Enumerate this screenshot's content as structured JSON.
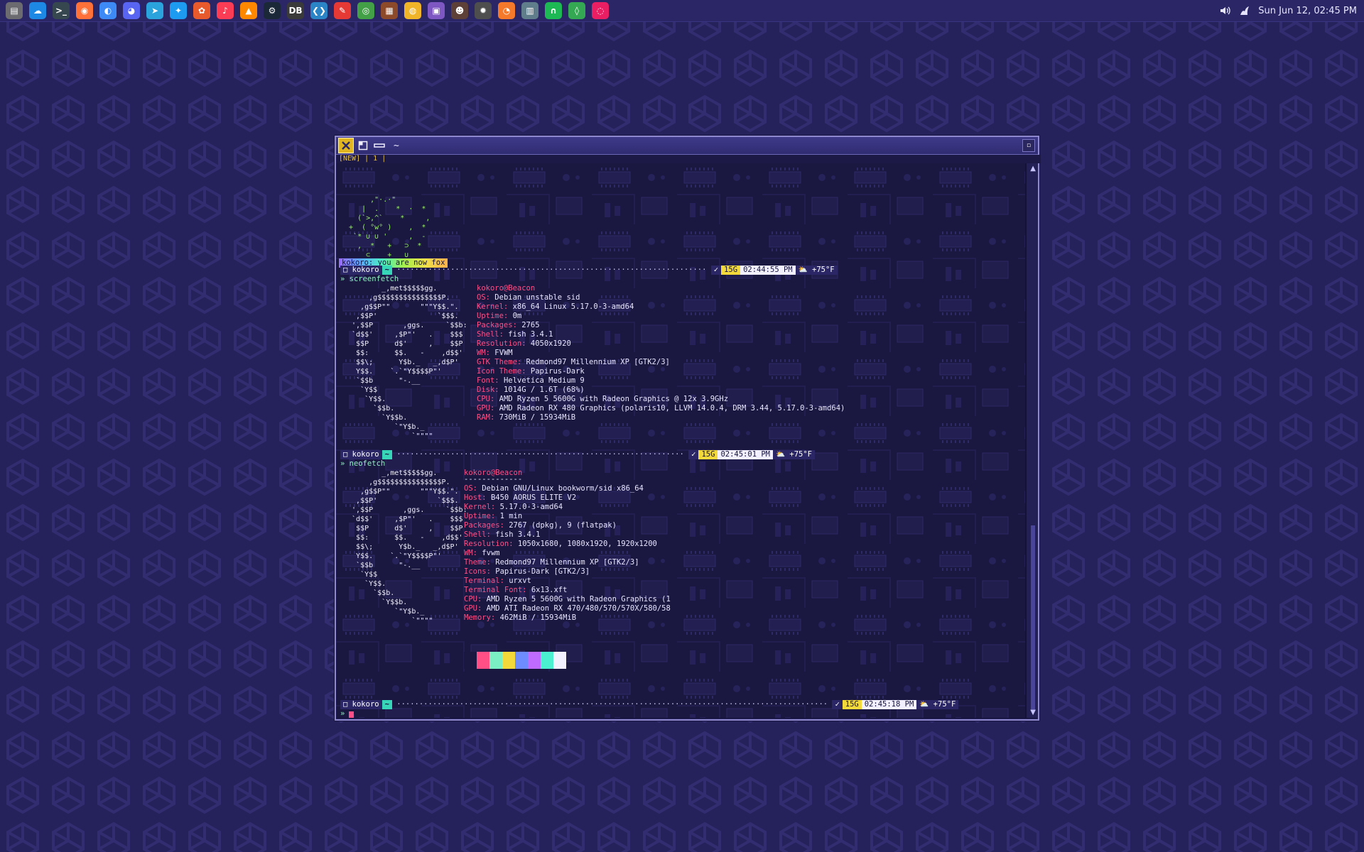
{
  "panel": {
    "launchers": [
      {
        "name": "files-icon",
        "glyph": "▤",
        "color": "#6c6c70"
      },
      {
        "name": "cloud-icon",
        "glyph": "☁",
        "color": "#1e88e5"
      },
      {
        "name": "terminal-icon",
        "glyph": ">_",
        "color": "#37474f"
      },
      {
        "name": "firefox-icon",
        "glyph": "◉",
        "color": "#ff7139"
      },
      {
        "name": "messenger-icon",
        "glyph": "◐",
        "color": "#3d8af7"
      },
      {
        "name": "discord-icon",
        "glyph": "◕",
        "color": "#5865f2"
      },
      {
        "name": "telegram-icon",
        "glyph": "➤",
        "color": "#2aa3dd"
      },
      {
        "name": "twitter-icon",
        "glyph": "✦",
        "color": "#1d9bf0"
      },
      {
        "name": "photos-icon",
        "glyph": "✿",
        "color": "#e85a2c"
      },
      {
        "name": "music-icon",
        "glyph": "♪",
        "color": "#fa3d55"
      },
      {
        "name": "vlc-icon",
        "glyph": "▲",
        "color": "#ff8800"
      },
      {
        "name": "steam-icon",
        "glyph": "⚙",
        "color": "#1b2838"
      },
      {
        "name": "dbeaver-icon",
        "glyph": "DB",
        "color": "#3a3a3a"
      },
      {
        "name": "vscode-icon",
        "glyph": "❮❯",
        "color": "#2b84c6"
      },
      {
        "name": "document-icon",
        "glyph": "✎",
        "color": "#e53935"
      },
      {
        "name": "owl-icon",
        "glyph": "◎",
        "color": "#43a047"
      },
      {
        "name": "archive-icon",
        "glyph": "▦",
        "color": "#8d4a2a"
      },
      {
        "name": "palette-icon",
        "glyph": "◍",
        "color": "#f0b429"
      },
      {
        "name": "chat-icon",
        "glyph": "▣",
        "color": "#7e57c2"
      },
      {
        "name": "game-icon",
        "glyph": "☻",
        "color": "#5d4037"
      },
      {
        "name": "bug-icon",
        "glyph": "✹",
        "color": "#4e4e4e"
      },
      {
        "name": "blender-icon",
        "glyph": "◔",
        "color": "#f5792a"
      },
      {
        "name": "spreadsheet-icon",
        "glyph": "▥",
        "color": "#607d8b"
      },
      {
        "name": "headphones-icon",
        "glyph": "∩",
        "color": "#1db954"
      },
      {
        "name": "maps-icon",
        "glyph": "◊",
        "color": "#34a853"
      },
      {
        "name": "bubble-icon",
        "glyph": "◌",
        "color": "#e91e63"
      }
    ],
    "clock": "Sun Jun 12, 02:45 PM"
  },
  "terminal": {
    "title": "~",
    "tabline": "[NEW] | 1 |",
    "fox": {
      "art": "       ,\"·.·\"\n     |  .    *  ·  *\n    (`>,^`    *     ,\n  +  ( °w° )    ,  *\n   `* ∪ ∪ '     ,  -\n    ,  *   +   ⊃  *\n      ⊂    +   ∪\n    *   o    +    *",
      "banner": "kokoro: you are now fox"
    },
    "prompts": [
      {
        "user": "kokoro",
        "path": "~",
        "ok": "✓",
        "jobs": "15G",
        "time": "02:44:55 PM",
        "weather": "⛅ +75°F"
      },
      {
        "user": "kokoro",
        "path": "~",
        "ok": "✓",
        "jobs": "15G",
        "time": "02:45:01 PM",
        "weather": "⛅ +75°F"
      },
      {
        "user": "kokoro",
        "path": "~",
        "ok": "✓",
        "jobs": "15G",
        "time": "02:45:18 PM",
        "weather": "⛅ +75°F"
      }
    ],
    "commands": [
      "» screenfetch",
      "» neofetch",
      "» "
    ],
    "debian_art": "         _,met$$$$$gg.\n      ,g$$$$$$$$$$$$$$$P.\n    ,g$$P\"\"       \"\"\"Y$$.\".\n   ,$$P'              `$$$.\n  ',$$P       ,ggs.     `$$b:\n  `d$$'     ,$P\"'   .    $$$\n   $$P      d$'     ,    $$P\n   $$:      $$.   -    ,d$$'\n   $$\\;      Y$b._   _,d$P'\n   Y$$.    `.`\"Y$$$$P\"'\n   `$$b      \"-.__\n    `Y$$\n     `Y$$.\n       `$$b.\n         `Y$$b.\n            `\"Y$b._\n                `\"\"\"\"",
    "screenfetch": {
      "header": "kokoro@Beacon",
      "rows": [
        {
          "k": "OS:",
          "v": "Debian unstable sid"
        },
        {
          "k": "Kernel:",
          "v": "x86_64 Linux 5.17.0-3-amd64"
        },
        {
          "k": "Uptime:",
          "v": "0m"
        },
        {
          "k": "Packages:",
          "v": "2765"
        },
        {
          "k": "Shell:",
          "v": "fish 3.4.1"
        },
        {
          "k": "Resolution:",
          "v": "4050x1920"
        },
        {
          "k": "WM:",
          "v": "FVWM"
        },
        {
          "k": "GTK Theme:",
          "v": "Redmond97 Millennium XP [GTK2/3]"
        },
        {
          "k": "Icon Theme:",
          "v": "Papirus-Dark"
        },
        {
          "k": "Font:",
          "v": "Helvetica Medium 9"
        },
        {
          "k": "Disk:",
          "v": "1014G / 1.6T (68%)"
        },
        {
          "k": "CPU:",
          "v": "AMD Ryzen 5 5600G with Radeon Graphics @ 12x 3.9GHz"
        },
        {
          "k": "GPU:",
          "v": "AMD Radeon RX 480 Graphics (polaris10, LLVM 14.0.4, DRM 3.44, 5.17.0-3-amd64)"
        },
        {
          "k": "RAM:",
          "v": "730MiB / 15934MiB"
        }
      ]
    },
    "neofetch": {
      "header": "kokoro@Beacon",
      "separator": "-------------",
      "rows": [
        {
          "k": "OS:",
          "v": "Debian GNU/Linux bookworm/sid x86_64"
        },
        {
          "k": "Host:",
          "v": "B450 AORUS ELITE V2"
        },
        {
          "k": "Kernel:",
          "v": "5.17.0-3-amd64"
        },
        {
          "k": "Uptime:",
          "v": "1 min"
        },
        {
          "k": "Packages:",
          "v": "2767 (dpkg), 9 (flatpak)"
        },
        {
          "k": "Shell:",
          "v": "fish 3.4.1"
        },
        {
          "k": "Resolution:",
          "v": "1050x1680, 1080x1920, 1920x1200"
        },
        {
          "k": "WM:",
          "v": "fvwm"
        },
        {
          "k": "Theme:",
          "v": "Redmond97 Millennium XP [GTK2/3]"
        },
        {
          "k": "Icons:",
          "v": "Papirus-Dark [GTK2/3]"
        },
        {
          "k": "Terminal:",
          "v": "urxvt"
        },
        {
          "k": "Terminal Font:",
          "v": "6x13.xft"
        },
        {
          "k": "CPU:",
          "v": "AMD Ryzen 5 5600G with Radeon Graphics (1"
        },
        {
          "k": "GPU:",
          "v": "AMD ATI Radeon RX 470/480/570/570X/580/58"
        },
        {
          "k": "Memory:",
          "v": "462MiB / 15934MiB"
        }
      ],
      "swatches": [
        "#1a1740",
        "#ff4f86",
        "#7af0c4",
        "#f4d93a",
        "#6f8cff",
        "#c06bff",
        "#4bf0d0",
        "#f2f0ff"
      ]
    }
  }
}
